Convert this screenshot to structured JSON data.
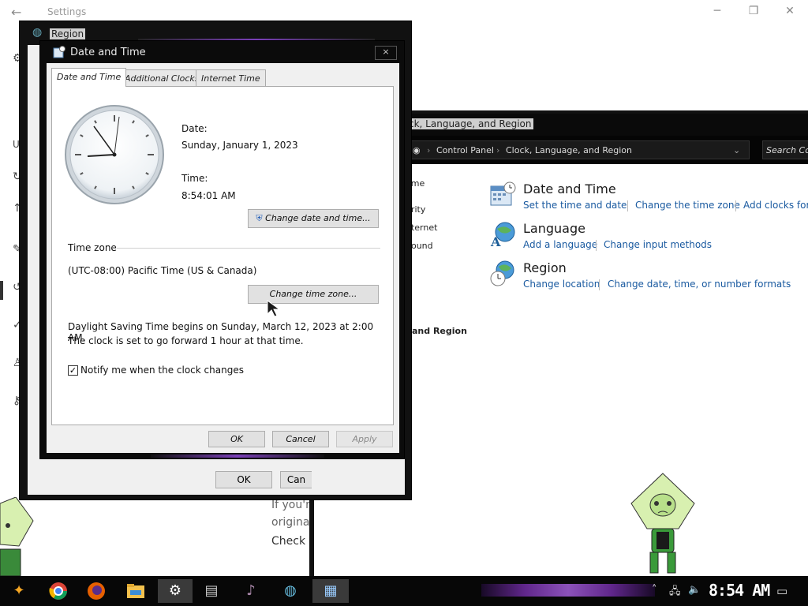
{
  "settings": {
    "title": "Settings",
    "back_icon": "back-arrow-icon",
    "left_letter": "U",
    "body_lines": [
      "If you'r",
      "origina",
      "Check I"
    ]
  },
  "control_panel": {
    "title": "ck, Language, and Region",
    "breadcrumb": [
      "Control Panel",
      "Clock, Language, and Region"
    ],
    "search_placeholder": "Search Co",
    "left_nav": [
      "ome",
      "urity",
      "nternet",
      "Sound",
      ", and Region"
    ],
    "categories": [
      {
        "title": "Date and Time",
        "icon": "calendar-clock-icon",
        "links": [
          "Set the time and date",
          "Change the time zone",
          "Add clocks for"
        ]
      },
      {
        "title": "Language",
        "icon": "language-globe-icon",
        "links": [
          "Add a language",
          "Change input methods"
        ]
      },
      {
        "title": "Region",
        "icon": "region-globe-clock-icon",
        "links": [
          "Change location",
          "Change date, time, or number formats"
        ]
      }
    ]
  },
  "region_dialog": {
    "title": "Region",
    "ok_label": "OK",
    "cancel_label": "Can"
  },
  "date_time_dialog": {
    "title": "Date and Time",
    "close_glyph": "×",
    "tabs": [
      "Date and Time",
      "Additional Clocks",
      "Internet Time"
    ],
    "date_label": "Date:",
    "date_value": "Sunday, January 1, 2023",
    "time_label": "Time:",
    "time_value": "8:54:01 AM",
    "change_datetime_label": "Change date and time...",
    "timezone_heading": "Time zone",
    "timezone_value": "(UTC-08:00) Pacific Time (US & Canada)",
    "change_timezone_label": "Change time zone...",
    "dst_line1": "Daylight Saving Time begins on Sunday, March 12, 2023 at 2:00 AM.",
    "dst_line2": "The clock is set to go forward 1 hour at that time.",
    "notify_label": "Notify me when the clock changes",
    "notify_checked": true,
    "ok_label": "OK",
    "cancel_label": "Cancel",
    "apply_label": "Apply"
  },
  "taskbar": {
    "clock": "8:54 AM",
    "apps": [
      "start-icon",
      "chrome-icon",
      "firefox-icon",
      "file-explorer-icon",
      "settings-icon",
      "control-panel-icon",
      "media-player-icon",
      "region-icon",
      "date-time-icon"
    ],
    "tray": [
      "chevron-up-icon",
      "network-icon",
      "volume-icon",
      "notification-icon"
    ]
  },
  "colors": {
    "accent_purple": "#7a3fb8",
    "link_blue": "#1a5aa0",
    "dark_chrome": "#0b0b0b",
    "dialog_face": "#f0f0f0"
  }
}
